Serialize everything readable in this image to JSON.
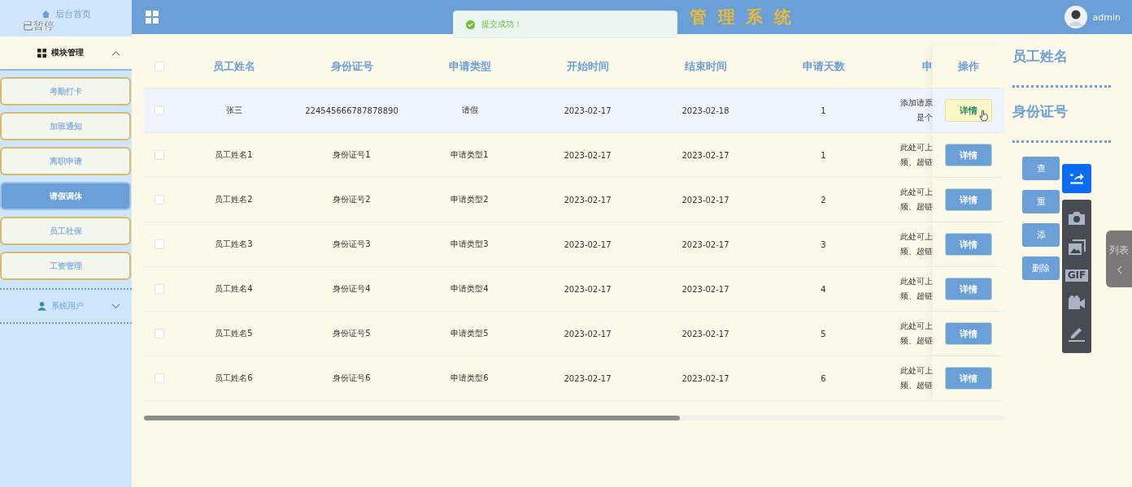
{
  "sidebar": {
    "home": {
      "label": "后台首页"
    },
    "recorder_status": "已暂停",
    "groups": [
      {
        "label": "模块管理",
        "expanded": true,
        "items": [
          {
            "label": "考勤打卡",
            "selected": false
          },
          {
            "label": "加班通知",
            "selected": false
          },
          {
            "label": "离职申请",
            "selected": false
          },
          {
            "label": "请假调休",
            "selected": true
          },
          {
            "label": "员工社保",
            "selected": false
          },
          {
            "label": "工资管理",
            "selected": false
          }
        ]
      },
      {
        "label": "系统用户",
        "expanded": false
      }
    ]
  },
  "header": {
    "title": "管理系统",
    "user": "admin"
  },
  "toast": {
    "message": "提交成功！"
  },
  "table": {
    "columns": [
      "员工姓名",
      "身份证号",
      "申请类型",
      "开始时间",
      "结束时间",
      "申请天数",
      "申"
    ],
    "action_column": "操作",
    "select_all_checked": false,
    "rows": [
      {
        "checked": false,
        "highlighted": true,
        "cells": [
          "张三",
          "224545666787878890",
          "请假",
          "2023-02-17",
          "2023-02-18",
          "1"
        ],
        "reason": [
          "添加请原",
          "是个"
        ],
        "action": "详情"
      },
      {
        "checked": false,
        "highlighted": false,
        "cells": [
          "员工姓名1",
          "身份证号1",
          "申请类型1",
          "2023-02-17",
          "2023-02-17",
          "1"
        ],
        "reason": [
          "此处可上",
          "频、超链"
        ],
        "action": "详情"
      },
      {
        "checked": false,
        "highlighted": false,
        "cells": [
          "员工姓名2",
          "身份证号2",
          "申请类型2",
          "2023-02-17",
          "2023-02-17",
          "2"
        ],
        "reason": [
          "此处可上",
          "频、超链"
        ],
        "action": "详情"
      },
      {
        "checked": false,
        "highlighted": false,
        "cells": [
          "员工姓名3",
          "身份证号3",
          "申请类型3",
          "2023-02-17",
          "2023-02-17",
          "3"
        ],
        "reason": [
          "此处可上",
          "频、超链"
        ],
        "action": "详情"
      },
      {
        "checked": false,
        "highlighted": false,
        "cells": [
          "员工姓名4",
          "身份证号4",
          "申请类型4",
          "2023-02-17",
          "2023-02-17",
          "4"
        ],
        "reason": [
          "此处可上",
          "频、超链"
        ],
        "action": "详情"
      },
      {
        "checked": false,
        "highlighted": false,
        "cells": [
          "员工姓名5",
          "身份证号5",
          "申请类型5",
          "2023-02-17",
          "2023-02-17",
          "5"
        ],
        "reason": [
          "此处可上",
          "频、超链"
        ],
        "action": "详情"
      },
      {
        "checked": false,
        "highlighted": false,
        "cells": [
          "员工姓名6",
          "身份证号6",
          "申请类型6",
          "2023-02-17",
          "2023-02-17",
          "6"
        ],
        "reason": [
          "此处可上",
          "频、超链"
        ],
        "action": "详情"
      }
    ]
  },
  "search_panel": {
    "labels": [
      "员工姓名",
      "身份证号"
    ],
    "buttons": [
      "查",
      "重",
      "添",
      "删除"
    ]
  },
  "capture_toolbar": {
    "gif_label": "GIF"
  },
  "side_tab": {
    "label": "列表"
  }
}
